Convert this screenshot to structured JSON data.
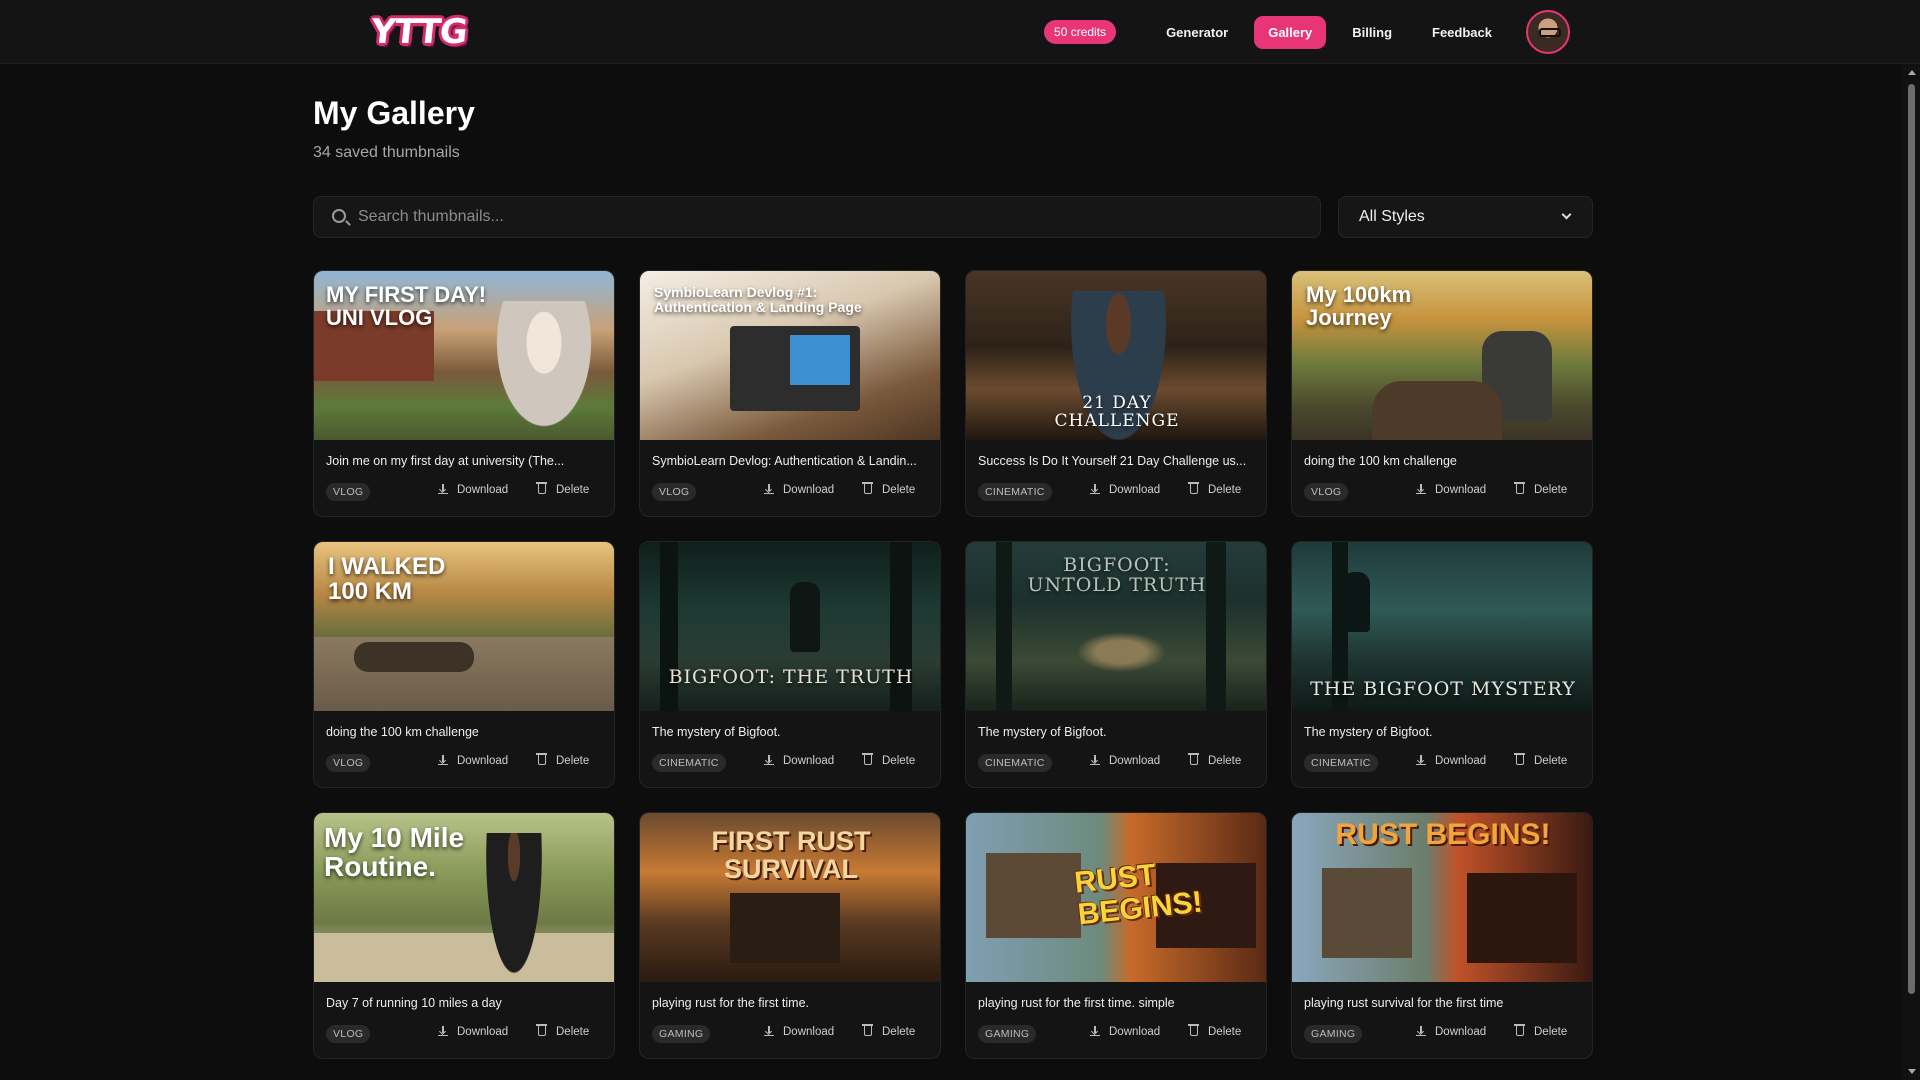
{
  "header": {
    "logo": "YTTG",
    "credits": "50 credits",
    "nav": [
      {
        "label": "Generator",
        "active": false
      },
      {
        "label": "Gallery",
        "active": true
      },
      {
        "label": "Billing",
        "active": false
      },
      {
        "label": "Feedback",
        "active": false
      }
    ]
  },
  "page": {
    "title": "My Gallery",
    "subtitle": "34 saved thumbnails"
  },
  "search": {
    "placeholder": "Search thumbnails..."
  },
  "style_filter": {
    "selected": "All Styles"
  },
  "actions": {
    "download": "Download",
    "delete": "Delete"
  },
  "cards": [
    {
      "title": "Join me on my first day at university (The...",
      "tag": "VLOG",
      "thumb_text": "MY FIRST DAY!\nUNI VLOG"
    },
    {
      "title": "SymbioLearn Devlog: Authentication & Landin...",
      "tag": "VLOG",
      "thumb_text": "SymbioLearn Devlog #1:\nAuthentication & Landing Page"
    },
    {
      "title": "Success Is Do It Yourself 21 Day Challenge us...",
      "tag": "CINEMATIC",
      "thumb_text": "21 DAY\nCHALLENGE"
    },
    {
      "title": "doing the 100 km challenge",
      "tag": "VLOG",
      "thumb_text": "My 100km\nJourney"
    },
    {
      "title": "doing the 100 km challenge",
      "tag": "VLOG",
      "thumb_text": "I WALKED\n100 KM"
    },
    {
      "title": "The mystery of Bigfoot.",
      "tag": "CINEMATIC",
      "thumb_text": "BIGFOOT: THE TRUTH"
    },
    {
      "title": "The mystery of Bigfoot.",
      "tag": "CINEMATIC",
      "thumb_text": "BIGFOOT:\nUNTOLD TRUTH"
    },
    {
      "title": "The mystery of Bigfoot.",
      "tag": "CINEMATIC",
      "thumb_text": "THE BIGFOOT MYSTERY"
    },
    {
      "title": "Day 7 of running 10 miles a day",
      "tag": "VLOG",
      "thumb_text": "My 10 Mile\nRoutine."
    },
    {
      "title": "playing rust for the first time.",
      "tag": "GAMING",
      "thumb_text": "FIRST RUST\nSURVIVAL"
    },
    {
      "title": "playing rust for the first time. simple",
      "tag": "GAMING",
      "thumb_text": "RUST\nBEGINS!"
    },
    {
      "title": "playing rust survival for the first time",
      "tag": "GAMING",
      "thumb_text": "RUST BEGINS!"
    }
  ],
  "colors": {
    "accent": "#e73575",
    "background": "#0d0d0d",
    "card": "#141414"
  }
}
